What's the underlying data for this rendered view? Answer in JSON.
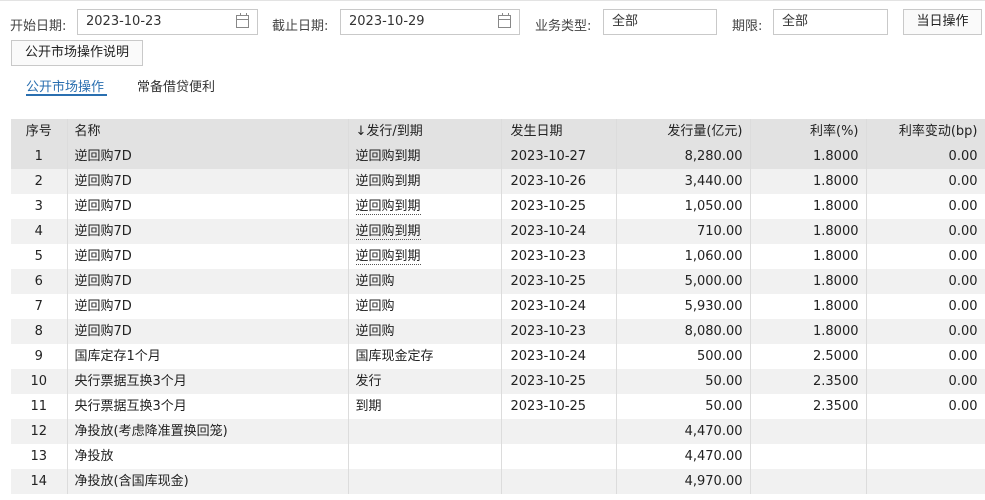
{
  "filters": {
    "start_label": "开始日期:",
    "start_value": "2023-10-23",
    "end_label": "截止日期:",
    "end_value": "2023-10-29",
    "biz_label": "业务类型:",
    "biz_value": "全部",
    "term_label": "期限:",
    "term_value": "全部",
    "today_button": "当日操作",
    "explain_button": "公开市场操作说明"
  },
  "tabs": [
    {
      "label": "公开市场操作",
      "active": true
    },
    {
      "label": "常备借贷便利",
      "active": false
    }
  ],
  "table": {
    "headers": [
      "序号",
      "名称",
      "↓发行/到期",
      "发生日期",
      "发行量(亿元)",
      "利率(%)",
      "利率变动(bp)"
    ],
    "rows": [
      {
        "idx": "1",
        "name": "逆回购7D",
        "type": "逆回购到期",
        "date": "2023-10-27",
        "amount": "8,280.00",
        "rate": "1.8000",
        "change": "0.00"
      },
      {
        "idx": "2",
        "name": "逆回购7D",
        "type": "逆回购到期",
        "date": "2023-10-26",
        "amount": "3,440.00",
        "rate": "1.8000",
        "change": "0.00"
      },
      {
        "idx": "3",
        "name": "逆回购7D",
        "type": "逆回购到期",
        "date": "2023-10-25",
        "amount": "1,050.00",
        "rate": "1.8000",
        "change": "0.00"
      },
      {
        "idx": "4",
        "name": "逆回购7D",
        "type": "逆回购到期",
        "date": "2023-10-24",
        "amount": "710.00",
        "rate": "1.8000",
        "change": "0.00"
      },
      {
        "idx": "5",
        "name": "逆回购7D",
        "type": "逆回购到期",
        "date": "2023-10-23",
        "amount": "1,060.00",
        "rate": "1.8000",
        "change": "0.00"
      },
      {
        "idx": "6",
        "name": "逆回购7D",
        "type": "逆回购",
        "date": "2023-10-25",
        "amount": "5,000.00",
        "rate": "1.8000",
        "change": "0.00"
      },
      {
        "idx": "7",
        "name": "逆回购7D",
        "type": "逆回购",
        "date": "2023-10-24",
        "amount": "5,930.00",
        "rate": "1.8000",
        "change": "0.00"
      },
      {
        "idx": "8",
        "name": "逆回购7D",
        "type": "逆回购",
        "date": "2023-10-23",
        "amount": "8,080.00",
        "rate": "1.8000",
        "change": "0.00"
      },
      {
        "idx": "9",
        "name": "国库定存1个月",
        "type": "国库现金定存",
        "date": "2023-10-24",
        "amount": "500.00",
        "rate": "2.5000",
        "change": "0.00"
      },
      {
        "idx": "10",
        "name": "央行票据互换3个月",
        "type": "发行",
        "date": "2023-10-25",
        "amount": "50.00",
        "rate": "2.3500",
        "change": "0.00"
      },
      {
        "idx": "11",
        "name": "央行票据互换3个月",
        "type": "到期",
        "date": "2023-10-25",
        "amount": "50.00",
        "rate": "2.3500",
        "change": "0.00"
      },
      {
        "idx": "12",
        "name": "净投放(考虑降准置换回笼)",
        "type": "",
        "date": "",
        "amount": "4,470.00",
        "rate": "",
        "change": ""
      },
      {
        "idx": "13",
        "name": "净投放",
        "type": "",
        "date": "",
        "amount": "4,470.00",
        "rate": "",
        "change": ""
      },
      {
        "idx": "14",
        "name": "净投放(含国库现金)",
        "type": "",
        "date": "",
        "amount": "4,970.00",
        "rate": "",
        "change": ""
      }
    ]
  }
}
